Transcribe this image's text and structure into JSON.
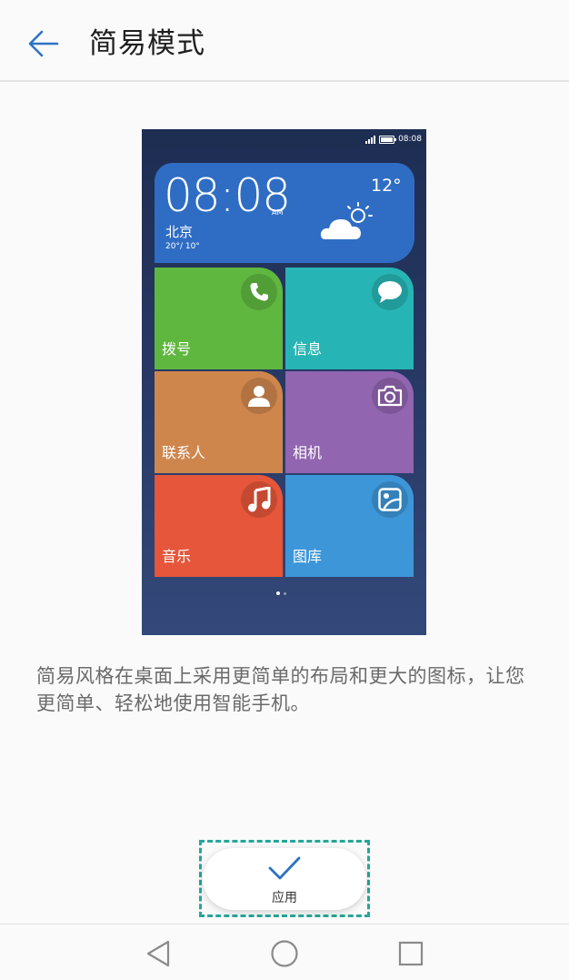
{
  "header": {
    "title": "简易模式"
  },
  "preview": {
    "status_time": "08:08",
    "weather": {
      "time": "08:08",
      "ampm": "AM",
      "city": "北京",
      "range": "20°/ 10°",
      "temperature": "12°"
    },
    "tiles": [
      {
        "label": "拨号",
        "color": "#5fb73f",
        "icon": "phone-icon"
      },
      {
        "label": "信息",
        "color": "#27b4b4",
        "icon": "message-icon"
      },
      {
        "label": "联系人",
        "color": "#ce864d",
        "icon": "contact-icon"
      },
      {
        "label": "相机",
        "color": "#9165b0",
        "icon": "camera-icon"
      },
      {
        "label": "音乐",
        "color": "#e5563a",
        "icon": "music-icon"
      },
      {
        "label": "图库",
        "color": "#3d96d8",
        "icon": "gallery-icon"
      }
    ]
  },
  "description": "简易风格在桌面上采用更简单的布局和更大的图标，让您更简单、轻松地使用智能手机。",
  "apply_button": {
    "label": "应用",
    "accent": "#2d72c4"
  },
  "colors": {
    "accent": "#2d72c4",
    "focus_outline": "#26a69a"
  }
}
